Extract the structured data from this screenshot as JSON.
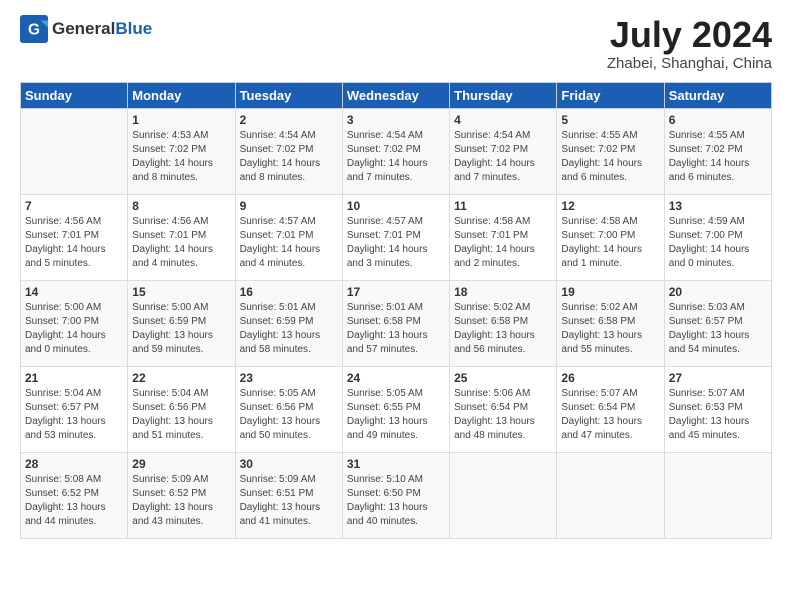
{
  "header": {
    "logo_general": "General",
    "logo_blue": "Blue",
    "month_year": "July 2024",
    "location": "Zhabei, Shanghai, China"
  },
  "weekdays": [
    "Sunday",
    "Monday",
    "Tuesday",
    "Wednesday",
    "Thursday",
    "Friday",
    "Saturday"
  ],
  "weeks": [
    [
      {
        "day": "",
        "info": ""
      },
      {
        "day": "1",
        "info": "Sunrise: 4:53 AM\nSunset: 7:02 PM\nDaylight: 14 hours\nand 8 minutes."
      },
      {
        "day": "2",
        "info": "Sunrise: 4:54 AM\nSunset: 7:02 PM\nDaylight: 14 hours\nand 8 minutes."
      },
      {
        "day": "3",
        "info": "Sunrise: 4:54 AM\nSunset: 7:02 PM\nDaylight: 14 hours\nand 7 minutes."
      },
      {
        "day": "4",
        "info": "Sunrise: 4:54 AM\nSunset: 7:02 PM\nDaylight: 14 hours\nand 7 minutes."
      },
      {
        "day": "5",
        "info": "Sunrise: 4:55 AM\nSunset: 7:02 PM\nDaylight: 14 hours\nand 6 minutes."
      },
      {
        "day": "6",
        "info": "Sunrise: 4:55 AM\nSunset: 7:02 PM\nDaylight: 14 hours\nand 6 minutes."
      }
    ],
    [
      {
        "day": "7",
        "info": "Sunrise: 4:56 AM\nSunset: 7:01 PM\nDaylight: 14 hours\nand 5 minutes."
      },
      {
        "day": "8",
        "info": "Sunrise: 4:56 AM\nSunset: 7:01 PM\nDaylight: 14 hours\nand 4 minutes."
      },
      {
        "day": "9",
        "info": "Sunrise: 4:57 AM\nSunset: 7:01 PM\nDaylight: 14 hours\nand 4 minutes."
      },
      {
        "day": "10",
        "info": "Sunrise: 4:57 AM\nSunset: 7:01 PM\nDaylight: 14 hours\nand 3 minutes."
      },
      {
        "day": "11",
        "info": "Sunrise: 4:58 AM\nSunset: 7:01 PM\nDaylight: 14 hours\nand 2 minutes."
      },
      {
        "day": "12",
        "info": "Sunrise: 4:58 AM\nSunset: 7:00 PM\nDaylight: 14 hours\nand 1 minute."
      },
      {
        "day": "13",
        "info": "Sunrise: 4:59 AM\nSunset: 7:00 PM\nDaylight: 14 hours\nand 0 minutes."
      }
    ],
    [
      {
        "day": "14",
        "info": "Sunrise: 5:00 AM\nSunset: 7:00 PM\nDaylight: 14 hours\nand 0 minutes."
      },
      {
        "day": "15",
        "info": "Sunrise: 5:00 AM\nSunset: 6:59 PM\nDaylight: 13 hours\nand 59 minutes."
      },
      {
        "day": "16",
        "info": "Sunrise: 5:01 AM\nSunset: 6:59 PM\nDaylight: 13 hours\nand 58 minutes."
      },
      {
        "day": "17",
        "info": "Sunrise: 5:01 AM\nSunset: 6:58 PM\nDaylight: 13 hours\nand 57 minutes."
      },
      {
        "day": "18",
        "info": "Sunrise: 5:02 AM\nSunset: 6:58 PM\nDaylight: 13 hours\nand 56 minutes."
      },
      {
        "day": "19",
        "info": "Sunrise: 5:02 AM\nSunset: 6:58 PM\nDaylight: 13 hours\nand 55 minutes."
      },
      {
        "day": "20",
        "info": "Sunrise: 5:03 AM\nSunset: 6:57 PM\nDaylight: 13 hours\nand 54 minutes."
      }
    ],
    [
      {
        "day": "21",
        "info": "Sunrise: 5:04 AM\nSunset: 6:57 PM\nDaylight: 13 hours\nand 53 minutes."
      },
      {
        "day": "22",
        "info": "Sunrise: 5:04 AM\nSunset: 6:56 PM\nDaylight: 13 hours\nand 51 minutes."
      },
      {
        "day": "23",
        "info": "Sunrise: 5:05 AM\nSunset: 6:56 PM\nDaylight: 13 hours\nand 50 minutes."
      },
      {
        "day": "24",
        "info": "Sunrise: 5:05 AM\nSunset: 6:55 PM\nDaylight: 13 hours\nand 49 minutes."
      },
      {
        "day": "25",
        "info": "Sunrise: 5:06 AM\nSunset: 6:54 PM\nDaylight: 13 hours\nand 48 minutes."
      },
      {
        "day": "26",
        "info": "Sunrise: 5:07 AM\nSunset: 6:54 PM\nDaylight: 13 hours\nand 47 minutes."
      },
      {
        "day": "27",
        "info": "Sunrise: 5:07 AM\nSunset: 6:53 PM\nDaylight: 13 hours\nand 45 minutes."
      }
    ],
    [
      {
        "day": "28",
        "info": "Sunrise: 5:08 AM\nSunset: 6:52 PM\nDaylight: 13 hours\nand 44 minutes."
      },
      {
        "day": "29",
        "info": "Sunrise: 5:09 AM\nSunset: 6:52 PM\nDaylight: 13 hours\nand 43 minutes."
      },
      {
        "day": "30",
        "info": "Sunrise: 5:09 AM\nSunset: 6:51 PM\nDaylight: 13 hours\nand 41 minutes."
      },
      {
        "day": "31",
        "info": "Sunrise: 5:10 AM\nSunset: 6:50 PM\nDaylight: 13 hours\nand 40 minutes."
      },
      {
        "day": "",
        "info": ""
      },
      {
        "day": "",
        "info": ""
      },
      {
        "day": "",
        "info": ""
      }
    ]
  ]
}
